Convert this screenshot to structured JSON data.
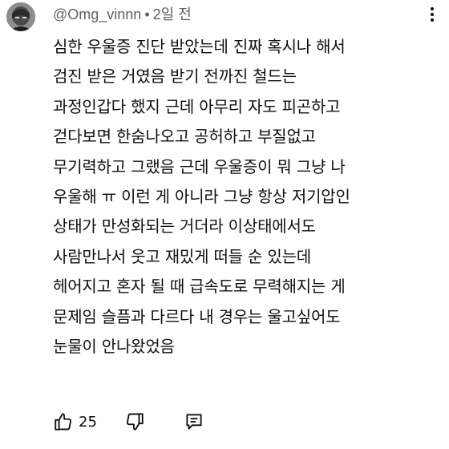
{
  "comment": {
    "author": "@Omg_vinnn",
    "separator": "•",
    "time": "2일 전",
    "lines": [
      "심한 우울증 진단 받았는데 진짜 혹시나 해서",
      "검진 받은 거였음 받기 전까진 철드는",
      "과정인갑다 했지 근데 아무리 자도 피곤하고",
      "걷다보면 한숨나오고 공허하고 부질없고",
      "무기력하고 그랬음 근데 우울증이 뭐 그냥 나",
      "우울해 ㅠ 이런 게 아니라 그냥 항상 저기압인",
      "상태가 만성화되는 거더라 이상태에서도",
      "사람만나서 웃고 재밌게 떠들 순 있는데",
      "헤어지고 혼자 될 때 급속도로 무력해지는 게",
      "문제임 슬픔과 다르다 내 경우는 울고싶어도",
      "눈물이 안나왔었음"
    ],
    "like_count": "25",
    "icons": {
      "like": "thumbs-up-icon",
      "dislike": "thumbs-down-icon",
      "reply": "comment-reply-icon",
      "more": "more-vertical-icon"
    }
  }
}
